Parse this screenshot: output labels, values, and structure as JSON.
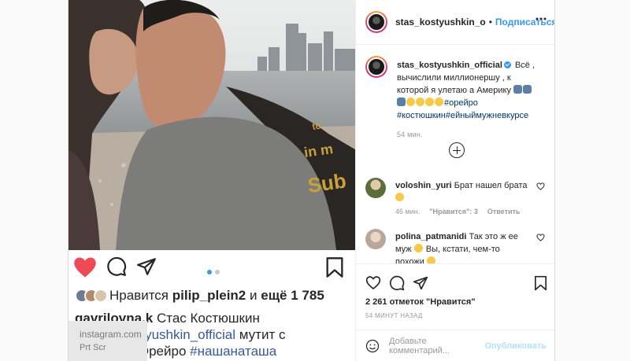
{
  "post": {
    "author": "stas_kostyushkin_o",
    "author_full": "stas_kostyushkin_official",
    "separator": "•",
    "follow_label": "Подписаться",
    "caption_line1": "Всё ,",
    "caption_line2": "вычислили миллионершу , к",
    "caption_line3": "которой я улетаю а Америку",
    "caption_tag1": "#орейро",
    "caption_tag2": "#костюшкин",
    "caption_tag3": "#ейныймужневкурсе",
    "caption_time": "54 мин.",
    "likes_label": "2 261 отметок \"Нравится\"",
    "timestamp": "54 МИНУТ НАЗАД",
    "add_comment_placeholder": "Добавьте комментарий...",
    "publish_label": "Опубликовать"
  },
  "comments": [
    {
      "user": "voloshin_yuri",
      "text": "Брат нашел брата",
      "time": "46 мин.",
      "likes": "\"Нравится\": 3",
      "reply": "Ответить"
    },
    {
      "user": "polina_patmanidi",
      "text_line1": "Так это ж ее",
      "text_line2": "муж",
      "text_line3": "Вы, кстати, чем-то",
      "text_line4": "похожи"
    }
  ],
  "embedded": {
    "likes_prefix": "Нравится",
    "likes_user": "pilip_plein2",
    "likes_mid": "и",
    "likes_rest": "ещё 1 785",
    "cap_user": "gavrilovna.k",
    "cap_text": "Стас Костюшкин",
    "cap_mention": "@stas_kostyushkin_official",
    "cap_text2": "мутит с",
    "cap_text3": "Натальей Орейро",
    "cap_hashtag": "#нашанаташа",
    "photo_shirt_text1": "in m",
    "photo_shirt_text2": "Sub",
    "photo_shirt_text3": "to"
  },
  "watermark": {
    "line1": "instagram.com",
    "line2": "Prt Scr"
  },
  "colors": {
    "accent": "#3897f0",
    "heart": "#ed4956",
    "tag": "#003569",
    "publish_disabled": "#b2dffc"
  },
  "icons": [
    "heart-icon",
    "comment-icon",
    "share-icon",
    "bookmark-icon",
    "more-icon",
    "plus-circle-icon",
    "smile-icon"
  ]
}
